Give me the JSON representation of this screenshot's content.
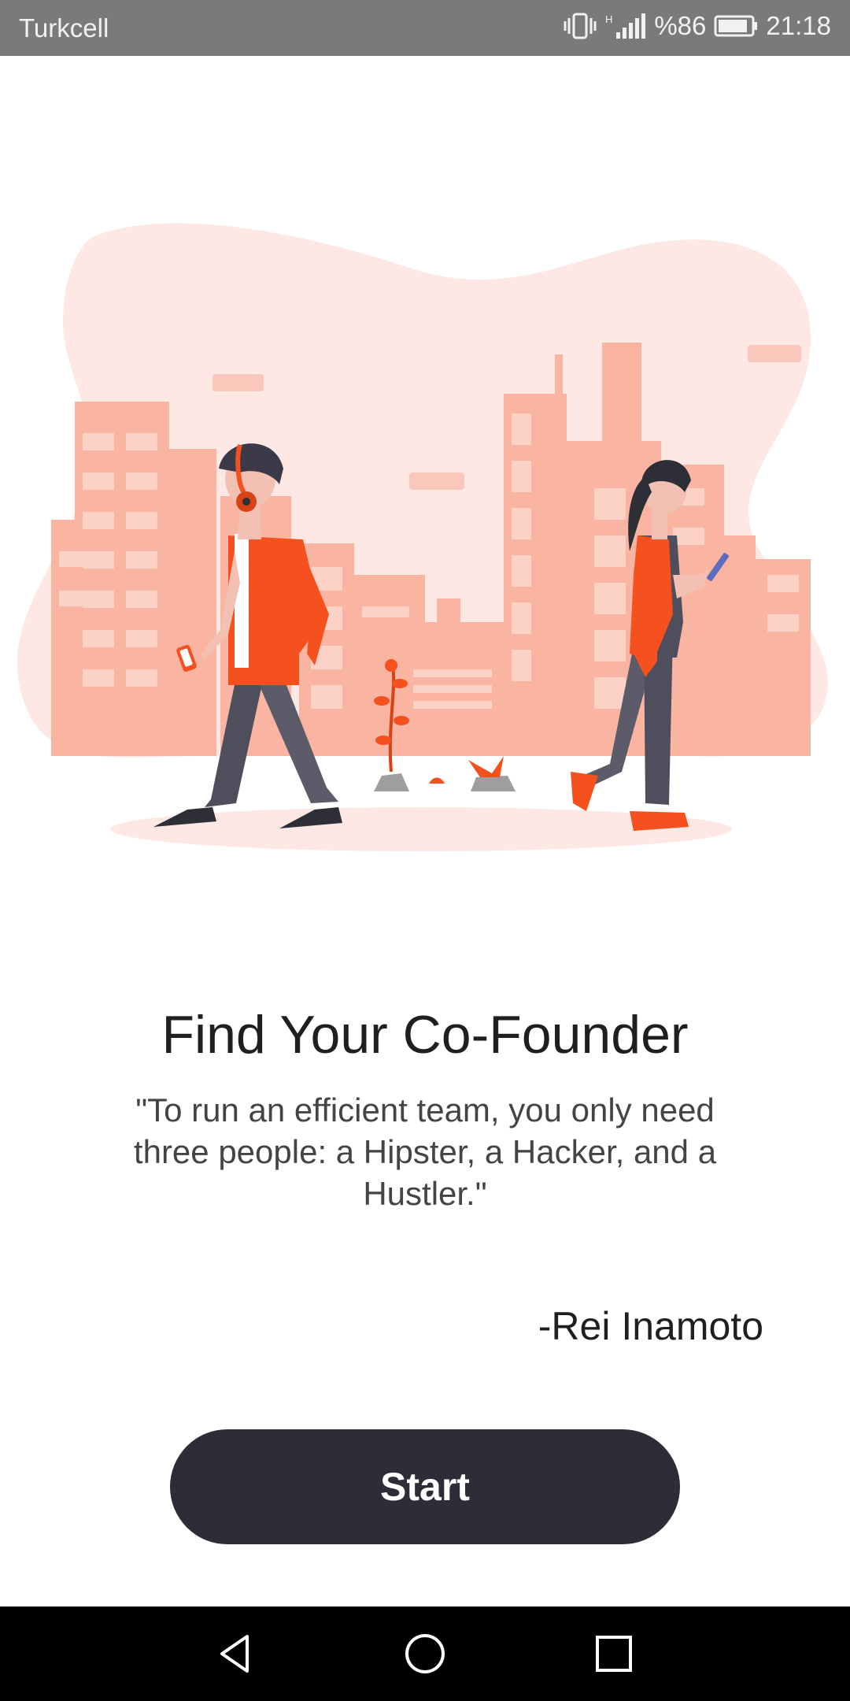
{
  "status_bar": {
    "carrier": "Turkcell",
    "battery": "%86",
    "time": "21:18"
  },
  "onboarding": {
    "title": "Find Your Co-Founder",
    "quote": "\"To run an efficient team, you only need three people: a Hipster, a Hacker, and a Hustler.\"",
    "author": "-Rei Inamoto",
    "start_label": "Start"
  },
  "colors": {
    "accent": "#f4511e",
    "button": "#2c2d39",
    "blob": "#fde8e3",
    "buildings": "#f9b5a2"
  },
  "icons": {
    "vibrate": "vibrate-icon",
    "signal": "signal-icon",
    "battery": "battery-icon",
    "back": "back-icon",
    "home": "home-icon",
    "recents": "recents-icon"
  }
}
